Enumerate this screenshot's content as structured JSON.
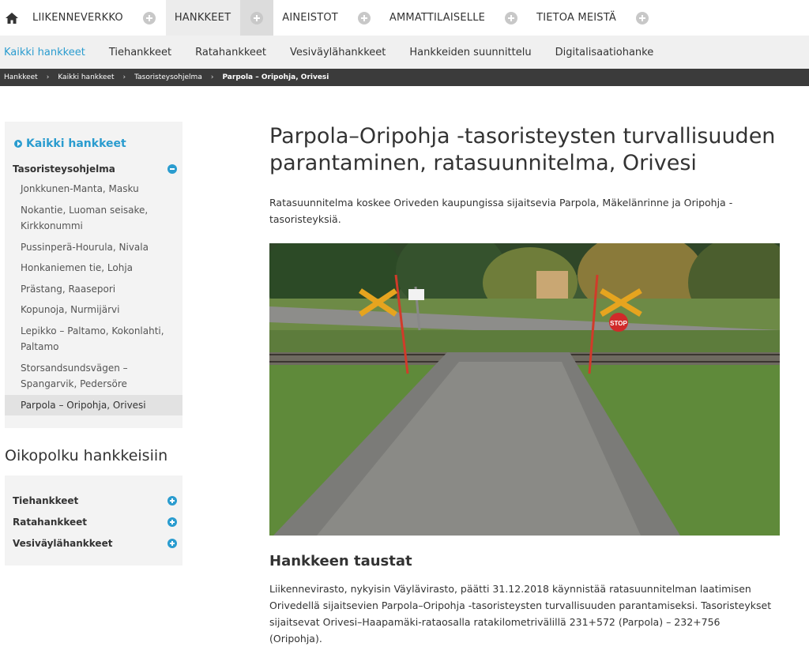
{
  "topnav": {
    "items": [
      {
        "label": "LIIKENNEVERKKO"
      },
      {
        "label": "HANKKEET"
      },
      {
        "label": "AINEISTOT"
      },
      {
        "label": "AMMATTILAISELLE"
      },
      {
        "label": "TIETOA MEISTÄ"
      }
    ]
  },
  "subnav": {
    "items": [
      {
        "label": "Kaikki hankkeet"
      },
      {
        "label": "Tiehankkeet"
      },
      {
        "label": "Ratahankkeet"
      },
      {
        "label": "Vesiväylähankkeet"
      },
      {
        "label": "Hankkeiden suunnittelu"
      },
      {
        "label": "Digitalisaatiohanke"
      }
    ]
  },
  "breadcrumb": [
    "Hankkeet",
    "Kaikki hankkeet",
    "Tasoristeysohjelma",
    "Parpola – Oripohja, Orivesi"
  ],
  "sidebar": {
    "back_label": "Kaikki hankkeet",
    "section_label": "Tasoristeysohjelma",
    "items": [
      "Jonkkunen-Manta, Masku",
      "Nokantie, Luoman seisake, Kirkkonummi",
      "Pussinperä-Hourula, Nivala",
      "Honkaniemen tie, Lohja",
      "Prästang, Raasepori",
      "Kopunoja, Nurmijärvi",
      "Lepikko – Paltamo, Kokonlahti, Paltamo",
      "Storsandsundsvägen – Spangarvik, Pedersöre",
      "Parpola – Oripohja, Orivesi"
    ]
  },
  "shortcuts": {
    "title": "Oikopolku hankkeisiin",
    "items": [
      "Tiehankkeet",
      "Ratahankkeet",
      "Vesiväylähankkeet"
    ]
  },
  "main": {
    "title": "Parpola–Oripohja -tasoristeysten turvallisuuden parantaminen, ratasuunnitelma, Orivesi",
    "intro": "Ratasuunnitelma koskee Oriveden kaupungissa sijaitsevia Parpola, Mäkelänrinne ja Oripohja -tasoristeyksiä.",
    "stop_sign": "STOP",
    "section_title": "Hankkeen taustat",
    "body": "Liikennevirasto, nykyisin Väylävirasto, päätti 31.12.2018 käynnistää ratasuunnitelman laatimisen Orivedellä sijaitsevien Parpola–Oripohja -tasoristeysten turvallisuuden parantamiseksi. Tasoristeykset sijaitsevat Orivesi–Haapamäki-rataosalla ratakilometrivälillä 231+572 (Parpola) – 232+756 (Oripohja)."
  },
  "colors": {
    "accent": "#2a9ccf",
    "breadcrumb_bg": "#3b3b3b"
  }
}
